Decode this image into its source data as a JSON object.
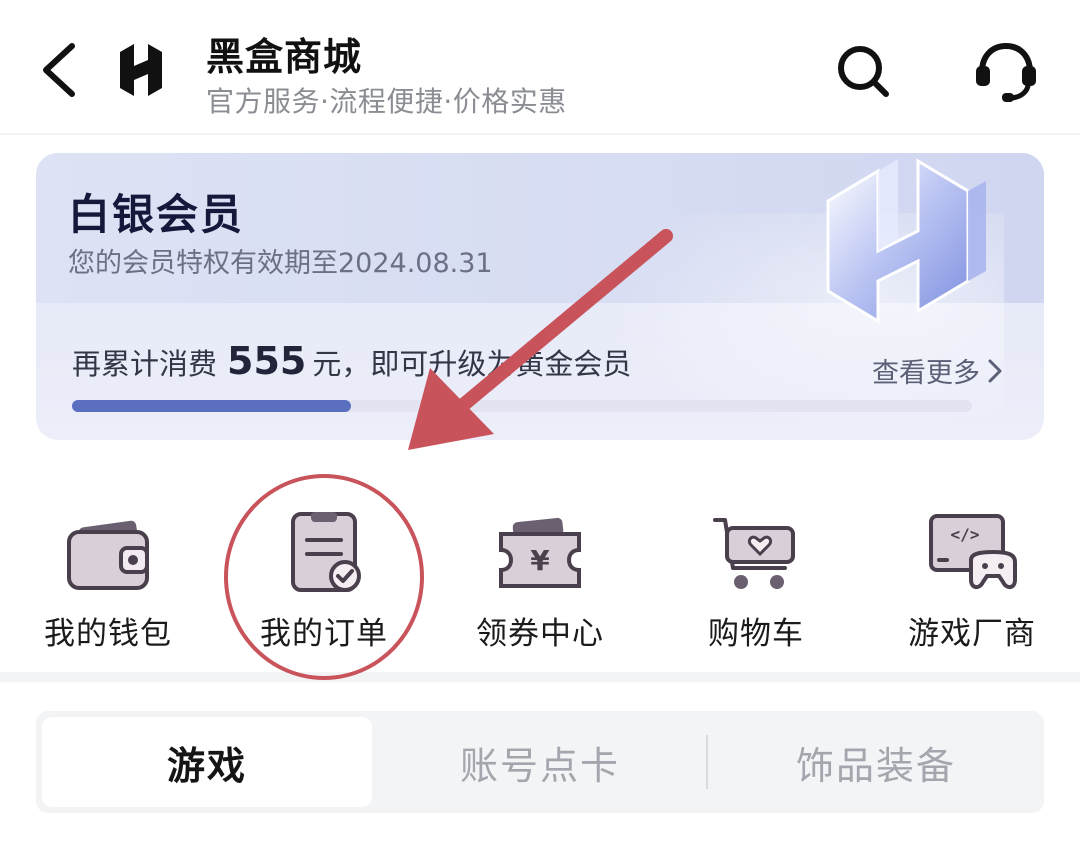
{
  "header": {
    "title": "黑盒商城",
    "subtitle": "官方服务·流程便捷·价格实惠",
    "icons": [
      "back-icon",
      "heybox-logo",
      "search-icon",
      "customer-service-icon"
    ]
  },
  "member_card": {
    "tier": "白银会员",
    "validity": "您的会员特权有效期至2024.08.31",
    "progress_prefix": "再累计消费",
    "amount": "555",
    "progress_suffix": "元，即可升级为黄金会员",
    "more_label": "查看更多",
    "progress_fraction": 0.31,
    "accent_color": "#5b6fc0"
  },
  "entries": [
    {
      "label": "我的钱包",
      "icon": "wallet-icon"
    },
    {
      "label": "我的订单",
      "icon": "order-icon"
    },
    {
      "label": "领券中心",
      "icon": "coupon-icon"
    },
    {
      "label": "购物车",
      "icon": "cart-icon"
    },
    {
      "label": "游戏厂商",
      "icon": "game-vendor-icon"
    }
  ],
  "tabs": [
    {
      "label": "游戏",
      "active": true
    },
    {
      "label": "账号点卡",
      "active": false
    },
    {
      "label": "饰品装备",
      "active": false
    }
  ],
  "annotation": {
    "highlight_color": "#c9535a",
    "highlighted_entry": "我的订单"
  }
}
